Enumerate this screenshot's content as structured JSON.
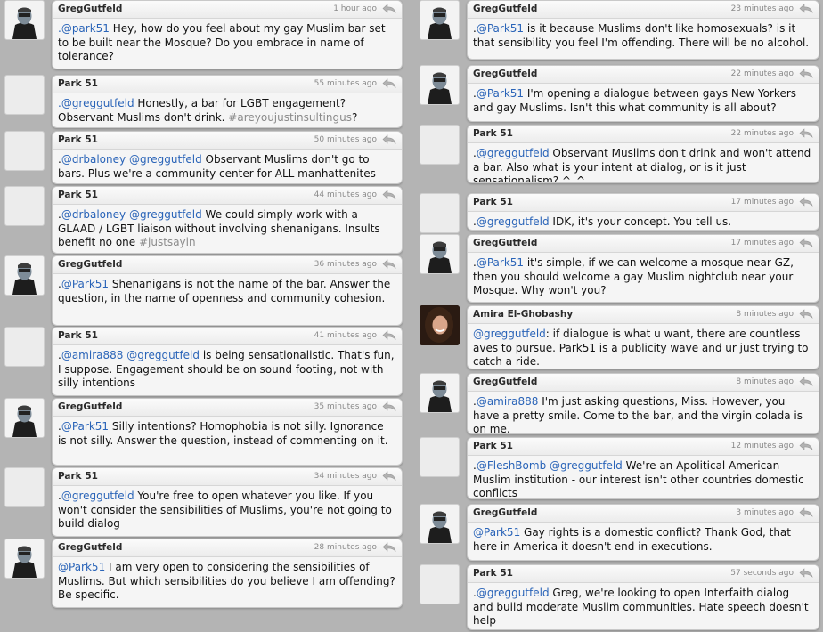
{
  "icons": {
    "reply": "reply-arrow-icon"
  },
  "colors": {
    "mention": "#2a64b8",
    "hashtag": "#8a8a8a",
    "background": "#b4b4b4"
  },
  "left_column": [
    {
      "author": "GregGutfeld",
      "avatar": "greggutfeld",
      "time": "1 hour ago",
      "segments": [
        {
          "t": "text",
          "v": "Hey, how do you feel about my gay Muslim bar set to be built near the Mosque? Do you embrace in name of tolerance?"
        }
      ],
      "mention_prefix": ".@park51"
    },
    {
      "author": "Park 51",
      "avatar": "empty",
      "time": "55 minutes ago",
      "segments": [
        {
          "t": "mention",
          "v": ".@greggutfeld"
        },
        {
          "t": "text",
          "v": " Honestly, a bar for LGBT engagement? Observant Muslims don't drink. "
        },
        {
          "t": "hashtag",
          "v": "#areyoujustinsultingus"
        },
        {
          "t": "text",
          "v": "?"
        }
      ]
    },
    {
      "author": "Park 51",
      "avatar": "empty",
      "time": "50 minutes ago",
      "segments": [
        {
          "t": "text",
          "v": "."
        },
        {
          "t": "mention",
          "v": "@drbaloney"
        },
        {
          "t": "text",
          "v": " "
        },
        {
          "t": "mention",
          "v": "@greggutfeld"
        },
        {
          "t": "text",
          "v": " Observant Muslims don't go to bars. Plus we're a community center for ALL manhattenites"
        }
      ]
    },
    {
      "author": "Park 51",
      "avatar": "empty",
      "time": "44 minutes ago",
      "segments": [
        {
          "t": "text",
          "v": "."
        },
        {
          "t": "mention",
          "v": "@drbaloney"
        },
        {
          "t": "text",
          "v": " "
        },
        {
          "t": "mention",
          "v": "@greggutfeld"
        },
        {
          "t": "text",
          "v": " We could simply work with a GLAAD / LGBT liaison without involving shenanigans. Insults benefit no one "
        },
        {
          "t": "hashtag",
          "v": "#justsayin"
        }
      ]
    },
    {
      "author": "GregGutfeld",
      "avatar": "greggutfeld",
      "time": "36 minutes ago",
      "segments": [
        {
          "t": "text",
          "v": "."
        },
        {
          "t": "mention",
          "v": "@Park51"
        },
        {
          "t": "text",
          "v": " Shenanigans is not the name of the bar. Answer the question, in the name of openness and community cohesion."
        }
      ]
    },
    {
      "author": "Park 51",
      "avatar": "empty",
      "time": "41 minutes ago",
      "segments": [
        {
          "t": "text",
          "v": "."
        },
        {
          "t": "mention",
          "v": "@amira888"
        },
        {
          "t": "text",
          "v": " "
        },
        {
          "t": "mention",
          "v": "@greggutfeld"
        },
        {
          "t": "text",
          "v": " is being sensationalistic. That's fun, I suppose. Engagement should be on sound footing, not with silly intentions"
        }
      ]
    },
    {
      "author": "GregGutfeld",
      "avatar": "greggutfeld",
      "time": "35 minutes ago",
      "segments": [
        {
          "t": "text",
          "v": "."
        },
        {
          "t": "mention",
          "v": "@Park51"
        },
        {
          "t": "text",
          "v": " Silly intentions? Homophobia is not silly. Ignorance is not silly. Answer the question, instead of commenting on it."
        }
      ]
    },
    {
      "author": "Park 51",
      "avatar": "empty",
      "time": "34 minutes ago",
      "segments": [
        {
          "t": "text",
          "v": "."
        },
        {
          "t": "mention",
          "v": "@greggutfeld"
        },
        {
          "t": "text",
          "v": " You're free to open whatever you like. If you won't consider the sensibilities of Muslims, you're not going to build dialog"
        }
      ]
    },
    {
      "author": "GregGutfeld",
      "avatar": "greggutfeld",
      "time": "28 minutes ago",
      "segments": [
        {
          "t": "mention",
          "v": "@Park51"
        },
        {
          "t": "text",
          "v": " I am very open to considering the sensibilities of Muslims. But which sensibilities do you believe I am offending? Be specific."
        }
      ]
    }
  ],
  "right_column": [
    {
      "author": "GregGutfeld",
      "avatar": "greggutfeld",
      "time": "23 minutes ago",
      "segments": [
        {
          "t": "text",
          "v": "."
        },
        {
          "t": "mention",
          "v": "@Park51"
        },
        {
          "t": "text",
          "v": " is it because Muslims don't like homosexuals? is it that sensibility you feel I'm offending. There will be no alcohol."
        }
      ]
    },
    {
      "author": "GregGutfeld",
      "avatar": "greggutfeld",
      "time": "22 minutes ago",
      "segments": [
        {
          "t": "text",
          "v": "."
        },
        {
          "t": "mention",
          "v": "@Park51"
        },
        {
          "t": "text",
          "v": " I'm opening a dialogue between gays New Yorkers and gay Muslims. Isn't this what community is all about?"
        }
      ]
    },
    {
      "author": "Park 51",
      "avatar": "empty",
      "time": "22 minutes ago",
      "segments": [
        {
          "t": "text",
          "v": "."
        },
        {
          "t": "mention",
          "v": "@greggutfeld"
        },
        {
          "t": "text",
          "v": " Observant Muslims don't drink and won't attend a bar. Also what is your intent at dialog, or is it just sensationalism? ^_^"
        }
      ]
    },
    {
      "author": "Park 51",
      "avatar": "empty",
      "time": "17 minutes ago",
      "segments": [
        {
          "t": "text",
          "v": "."
        },
        {
          "t": "mention",
          "v": "@greggutfeld"
        },
        {
          "t": "text",
          "v": " IDK, it's your concept. You tell us."
        }
      ]
    },
    {
      "author": "GregGutfeld",
      "avatar": "greggutfeld",
      "time": "17 minutes ago",
      "segments": [
        {
          "t": "text",
          "v": "."
        },
        {
          "t": "mention",
          "v": "@Park51"
        },
        {
          "t": "text",
          "v": " it's simple, if we can welcome a mosque near GZ, then you should welcome a gay Muslim nightclub near your Mosque. Why won't you?"
        }
      ]
    },
    {
      "author": "Amira El-Ghobashy",
      "avatar": "amira",
      "time": "8 minutes ago",
      "segments": [
        {
          "t": "mention",
          "v": "@greggutfeld"
        },
        {
          "t": "text",
          "v": ": if dialogue is what u want, there are countless aves to pursue. Park51 is a publicity wave and ur just trying to catch a ride."
        }
      ]
    },
    {
      "author": "GregGutfeld",
      "avatar": "greggutfeld",
      "time": "8 minutes ago",
      "segments": [
        {
          "t": "text",
          "v": "."
        },
        {
          "t": "mention",
          "v": "@amira888"
        },
        {
          "t": "text",
          "v": " I'm just asking questions, Miss. However, you have a pretty smile. Come to the bar, and the virgin colada is on me."
        }
      ]
    },
    {
      "author": "Park 51",
      "avatar": "empty",
      "time": "12 minutes ago",
      "segments": [
        {
          "t": "text",
          "v": "."
        },
        {
          "t": "mention",
          "v": "@FleshBomb"
        },
        {
          "t": "text",
          "v": " "
        },
        {
          "t": "mention",
          "v": "@greggutfeld"
        },
        {
          "t": "text",
          "v": " We're an Apolitical American Muslim institution - our interest isn't other countries domestic conflicts"
        }
      ]
    },
    {
      "author": "GregGutfeld",
      "avatar": "greggutfeld",
      "time": "3 minutes ago",
      "segments": [
        {
          "t": "mention",
          "v": "@Park51"
        },
        {
          "t": "text",
          "v": " Gay rights is a domestic conflict? Thank God, that here in America it doesn't end in executions."
        }
      ]
    },
    {
      "author": "Park 51",
      "avatar": "empty",
      "time": "57 seconds ago",
      "segments": [
        {
          "t": "text",
          "v": "."
        },
        {
          "t": "mention",
          "v": "@greggutfeld"
        },
        {
          "t": "text",
          "v": " Greg, we're looking to open Interfaith dialog and build moderate Muslim communities. Hate speech doesn't help"
        }
      ]
    }
  ]
}
